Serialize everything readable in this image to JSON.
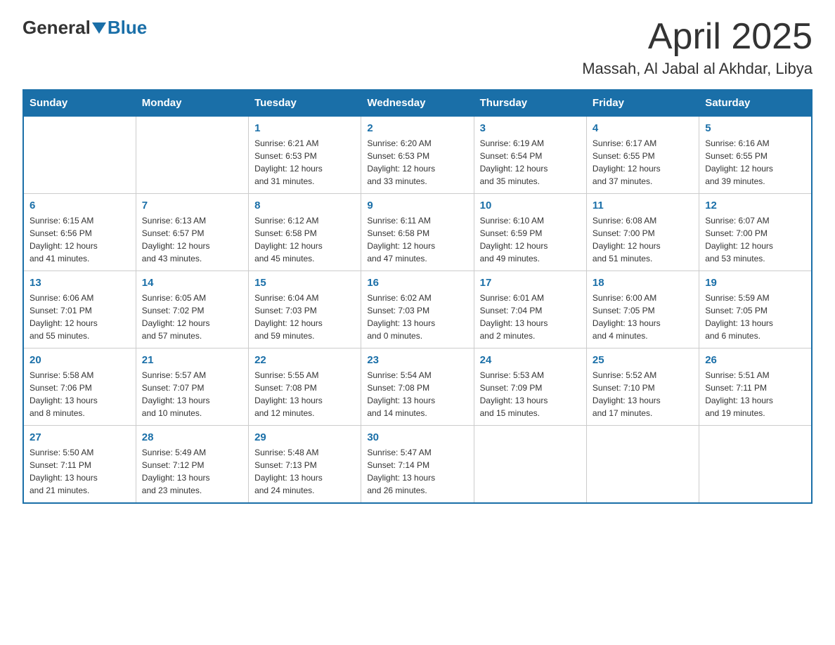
{
  "header": {
    "logo_general": "General",
    "logo_blue": "Blue",
    "month_title": "April 2025",
    "location": "Massah, Al Jabal al Akhdar, Libya"
  },
  "weekdays": [
    "Sunday",
    "Monday",
    "Tuesday",
    "Wednesday",
    "Thursday",
    "Friday",
    "Saturday"
  ],
  "weeks": [
    [
      {
        "day": "",
        "info": ""
      },
      {
        "day": "",
        "info": ""
      },
      {
        "day": "1",
        "info": "Sunrise: 6:21 AM\nSunset: 6:53 PM\nDaylight: 12 hours\nand 31 minutes."
      },
      {
        "day": "2",
        "info": "Sunrise: 6:20 AM\nSunset: 6:53 PM\nDaylight: 12 hours\nand 33 minutes."
      },
      {
        "day": "3",
        "info": "Sunrise: 6:19 AM\nSunset: 6:54 PM\nDaylight: 12 hours\nand 35 minutes."
      },
      {
        "day": "4",
        "info": "Sunrise: 6:17 AM\nSunset: 6:55 PM\nDaylight: 12 hours\nand 37 minutes."
      },
      {
        "day": "5",
        "info": "Sunrise: 6:16 AM\nSunset: 6:55 PM\nDaylight: 12 hours\nand 39 minutes."
      }
    ],
    [
      {
        "day": "6",
        "info": "Sunrise: 6:15 AM\nSunset: 6:56 PM\nDaylight: 12 hours\nand 41 minutes."
      },
      {
        "day": "7",
        "info": "Sunrise: 6:13 AM\nSunset: 6:57 PM\nDaylight: 12 hours\nand 43 minutes."
      },
      {
        "day": "8",
        "info": "Sunrise: 6:12 AM\nSunset: 6:58 PM\nDaylight: 12 hours\nand 45 minutes."
      },
      {
        "day": "9",
        "info": "Sunrise: 6:11 AM\nSunset: 6:58 PM\nDaylight: 12 hours\nand 47 minutes."
      },
      {
        "day": "10",
        "info": "Sunrise: 6:10 AM\nSunset: 6:59 PM\nDaylight: 12 hours\nand 49 minutes."
      },
      {
        "day": "11",
        "info": "Sunrise: 6:08 AM\nSunset: 7:00 PM\nDaylight: 12 hours\nand 51 minutes."
      },
      {
        "day": "12",
        "info": "Sunrise: 6:07 AM\nSunset: 7:00 PM\nDaylight: 12 hours\nand 53 minutes."
      }
    ],
    [
      {
        "day": "13",
        "info": "Sunrise: 6:06 AM\nSunset: 7:01 PM\nDaylight: 12 hours\nand 55 minutes."
      },
      {
        "day": "14",
        "info": "Sunrise: 6:05 AM\nSunset: 7:02 PM\nDaylight: 12 hours\nand 57 minutes."
      },
      {
        "day": "15",
        "info": "Sunrise: 6:04 AM\nSunset: 7:03 PM\nDaylight: 12 hours\nand 59 minutes."
      },
      {
        "day": "16",
        "info": "Sunrise: 6:02 AM\nSunset: 7:03 PM\nDaylight: 13 hours\nand 0 minutes."
      },
      {
        "day": "17",
        "info": "Sunrise: 6:01 AM\nSunset: 7:04 PM\nDaylight: 13 hours\nand 2 minutes."
      },
      {
        "day": "18",
        "info": "Sunrise: 6:00 AM\nSunset: 7:05 PM\nDaylight: 13 hours\nand 4 minutes."
      },
      {
        "day": "19",
        "info": "Sunrise: 5:59 AM\nSunset: 7:05 PM\nDaylight: 13 hours\nand 6 minutes."
      }
    ],
    [
      {
        "day": "20",
        "info": "Sunrise: 5:58 AM\nSunset: 7:06 PM\nDaylight: 13 hours\nand 8 minutes."
      },
      {
        "day": "21",
        "info": "Sunrise: 5:57 AM\nSunset: 7:07 PM\nDaylight: 13 hours\nand 10 minutes."
      },
      {
        "day": "22",
        "info": "Sunrise: 5:55 AM\nSunset: 7:08 PM\nDaylight: 13 hours\nand 12 minutes."
      },
      {
        "day": "23",
        "info": "Sunrise: 5:54 AM\nSunset: 7:08 PM\nDaylight: 13 hours\nand 14 minutes."
      },
      {
        "day": "24",
        "info": "Sunrise: 5:53 AM\nSunset: 7:09 PM\nDaylight: 13 hours\nand 15 minutes."
      },
      {
        "day": "25",
        "info": "Sunrise: 5:52 AM\nSunset: 7:10 PM\nDaylight: 13 hours\nand 17 minutes."
      },
      {
        "day": "26",
        "info": "Sunrise: 5:51 AM\nSunset: 7:11 PM\nDaylight: 13 hours\nand 19 minutes."
      }
    ],
    [
      {
        "day": "27",
        "info": "Sunrise: 5:50 AM\nSunset: 7:11 PM\nDaylight: 13 hours\nand 21 minutes."
      },
      {
        "day": "28",
        "info": "Sunrise: 5:49 AM\nSunset: 7:12 PM\nDaylight: 13 hours\nand 23 minutes."
      },
      {
        "day": "29",
        "info": "Sunrise: 5:48 AM\nSunset: 7:13 PM\nDaylight: 13 hours\nand 24 minutes."
      },
      {
        "day": "30",
        "info": "Sunrise: 5:47 AM\nSunset: 7:14 PM\nDaylight: 13 hours\nand 26 minutes."
      },
      {
        "day": "",
        "info": ""
      },
      {
        "day": "",
        "info": ""
      },
      {
        "day": "",
        "info": ""
      }
    ]
  ]
}
